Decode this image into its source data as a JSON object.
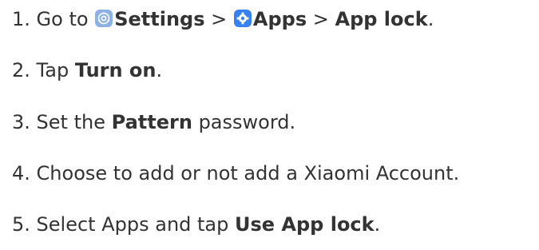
{
  "steps": [
    {
      "number": "1.",
      "prefix": "Go to",
      "settings": "Settings",
      "sep1": ">",
      "apps": "Apps",
      "sep2": ">",
      "app_lock": "App lock",
      "end": "."
    },
    {
      "number": "2.",
      "prefix": "Tap",
      "bold": "Turn on",
      "end": "."
    },
    {
      "number": "3.",
      "prefix": "Set the",
      "bold": "Pattern",
      "suffix": "password."
    },
    {
      "number": "4.",
      "text": "Choose to add or not add a Xiaomi Account."
    },
    {
      "number": "5.",
      "prefix": "Select Apps and tap",
      "bold": "Use App lock",
      "end": "."
    }
  ],
  "icons": {
    "settings": "gear-icon",
    "apps": "apps-gear-icon"
  },
  "colors": {
    "text": "#333333",
    "settings_icon_bg": "#8db1e4",
    "apps_icon_bg": "#3582f0"
  }
}
